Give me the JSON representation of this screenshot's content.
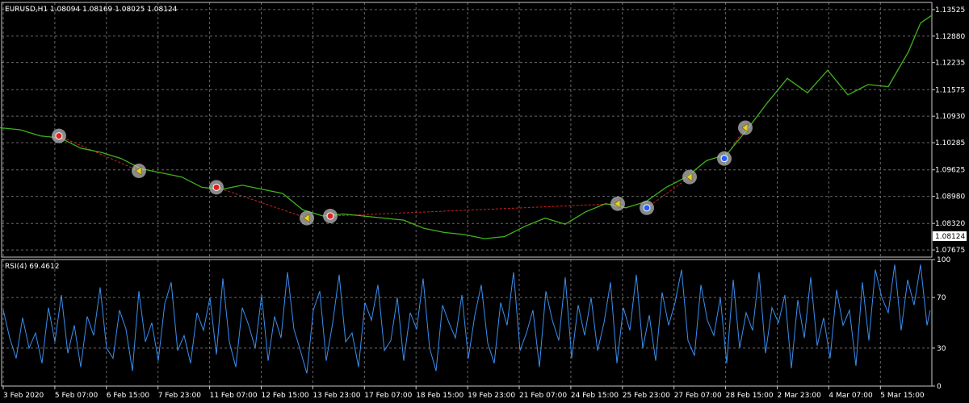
{
  "chart_data": [
    {
      "type": "line",
      "panel": "price",
      "title": "EURUSD,H1  1.08094 1.08169 1.08025 1.08124",
      "y_tick_labels": [
        "1.13525",
        "1.12880",
        "1.12235",
        "1.11575",
        "1.10930",
        "1.10285",
        "1.09625",
        "1.08980",
        "1.08320",
        "1.07675"
      ],
      "ylim": [
        1.075,
        1.137
      ],
      "current_price_label": "1.08124",
      "series": [
        {
          "color": "#3fb51b",
          "x": [
            0,
            25,
            50,
            75,
            100,
            125,
            150,
            175,
            200,
            225,
            250,
            275,
            300,
            325,
            350,
            375,
            400,
            425,
            450,
            475,
            500,
            525,
            550,
            575,
            600,
            625,
            650,
            675,
            700,
            725,
            750,
            775,
            800,
            825,
            850,
            875,
            900,
            925,
            950,
            975,
            1000,
            1025,
            1050,
            1075,
            1100,
            1125,
            1140,
            1155
          ],
          "values": [
            1.1065,
            1.106,
            1.1045,
            1.104,
            1.1015,
            1.1005,
            1.099,
            1.0965,
            1.0955,
            1.0945,
            1.092,
            1.0915,
            1.0925,
            1.0915,
            1.0905,
            1.0865,
            1.085,
            1.0855,
            1.085,
            1.0845,
            1.084,
            1.082,
            1.081,
            1.0805,
            1.0795,
            1.08,
            1.0825,
            1.0845,
            1.083,
            1.086,
            1.088,
            1.087,
            1.0885,
            1.092,
            1.0945,
            1.0985,
            1.1,
            1.106,
            1.1125,
            1.1185,
            1.115,
            1.1205,
            1.1145,
            1.117,
            1.1165,
            1.125,
            1.132,
            1.134
          ]
        }
      ],
      "markers": [
        {
          "x": 73,
          "y": 1.1045,
          "kind": "red"
        },
        {
          "x": 172,
          "y": 1.096,
          "kind": "yellow"
        },
        {
          "x": 268,
          "y": 1.092,
          "kind": "red"
        },
        {
          "x": 380,
          "y": 1.0845,
          "kind": "yellow"
        },
        {
          "x": 409,
          "y": 1.085,
          "kind": "red"
        },
        {
          "x": 765,
          "y": 1.088,
          "kind": "yellow"
        },
        {
          "x": 801,
          "y": 1.087,
          "kind": "blue"
        },
        {
          "x": 854,
          "y": 1.0945,
          "kind": "yellow"
        },
        {
          "x": 897,
          "y": 1.099,
          "kind": "blue"
        },
        {
          "x": 923,
          "y": 1.1065,
          "kind": "yellow"
        }
      ],
      "trade_lines": [
        {
          "x1": 73,
          "y1": 1.1045,
          "x2": 172,
          "y2": 1.096
        },
        {
          "x1": 268,
          "y1": 1.092,
          "x2": 380,
          "y2": 1.0845
        },
        {
          "x1": 409,
          "y1": 1.085,
          "x2": 765,
          "y2": 1.088
        },
        {
          "x1": 801,
          "y1": 1.087,
          "x2": 854,
          "y2": 1.0945
        },
        {
          "x1": 897,
          "y1": 1.099,
          "x2": 923,
          "y2": 1.1065
        }
      ]
    },
    {
      "type": "line",
      "panel": "indicator",
      "title": "RSI(4) 69.4612",
      "y_tick_labels": [
        "100",
        "70",
        "30",
        "0"
      ],
      "levels": [
        70,
        30
      ],
      "ylim": [
        0,
        100
      ],
      "series": [
        {
          "color": "#3a8ff0",
          "x": [
            4,
            12,
            20,
            28,
            36,
            44,
            52,
            60,
            68,
            76,
            84,
            92,
            100,
            108,
            116,
            124,
            132,
            140,
            148,
            156,
            164,
            172,
            180,
            188,
            196,
            204,
            212,
            220,
            228,
            236,
            244,
            252,
            260,
            268,
            276,
            284,
            292,
            300,
            308,
            316,
            324,
            332,
            340,
            348,
            356,
            364,
            372,
            380,
            388,
            396,
            404,
            412,
            420,
            428,
            436,
            444,
            452,
            460,
            468,
            476,
            484,
            492,
            500,
            508,
            516,
            524,
            532,
            540,
            548,
            556,
            564,
            572,
            580,
            588,
            596,
            604,
            612,
            620,
            628,
            636,
            644,
            652,
            660,
            668,
            676,
            684,
            692,
            700,
            708,
            716,
            724,
            732,
            740,
            748,
            756,
            764,
            772,
            780,
            788,
            796,
            804,
            812,
            820,
            828,
            836,
            844,
            852,
            860,
            868,
            876,
            884,
            892,
            900,
            908,
            916,
            924,
            932,
            940,
            948,
            956,
            964,
            972,
            980,
            988,
            996,
            1004,
            1012,
            1020,
            1028,
            1036,
            1044,
            1052,
            1060,
            1068,
            1076,
            1084,
            1092,
            1100,
            1108,
            1116,
            1124,
            1132,
            1140,
            1148,
            1152
          ],
          "values": [
            60,
            38,
            22,
            54,
            30,
            42,
            18,
            62,
            35,
            72,
            26,
            48,
            15,
            55,
            40,
            78,
            30,
            22,
            60,
            45,
            12,
            75,
            35,
            50,
            20,
            65,
            82,
            28,
            40,
            18,
            58,
            44,
            70,
            25,
            85,
            35,
            15,
            62,
            48,
            30,
            72,
            20,
            55,
            38,
            90,
            45,
            28,
            10,
            60,
            75,
            20,
            50,
            88,
            35,
            42,
            15,
            66,
            52,
            80,
            28,
            36,
            70,
            20,
            58,
            45,
            85,
            30,
            12,
            64,
            50,
            38,
            72,
            22,
            56,
            80,
            34,
            18,
            66,
            48,
            90,
            28,
            42,
            60,
            15,
            75,
            52,
            36,
            86,
            22,
            64,
            40,
            70,
            28,
            50,
            82,
            18,
            62,
            44,
            88,
            30,
            56,
            20,
            74,
            48,
            66,
            92,
            36,
            24,
            80,
            52,
            40,
            70,
            18,
            84,
            30,
            58,
            44,
            90,
            26,
            62,
            50,
            72,
            14,
            68,
            38,
            86,
            32,
            54,
            22,
            76,
            48,
            60,
            16,
            82,
            36,
            92,
            70,
            58,
            96,
            44,
            84,
            64,
            96,
            48,
            60
          ]
        }
      ]
    }
  ],
  "x_tick_labels": [
    "3 Feb 2020",
    "5 Feb 07:00",
    "6 Feb 15:00",
    "7 Feb 23:00",
    "11 Feb 07:00",
    "12 Feb 15:00",
    "13 Feb 23:00",
    "17 Feb 07:00",
    "18 Feb 15:00",
    "19 Feb 23:00",
    "21 Feb 07:00",
    "24 Feb 15:00",
    "25 Feb 23:00",
    "27 Feb 07:00",
    "28 Feb 15:00",
    "2 Mar 23:00",
    "4 Mar 07:00",
    "5 Mar 15:00"
  ],
  "colors": {
    "background": "#000000",
    "price_line": "#3fb51b",
    "rsi_line": "#3a8ff0",
    "trade_line": "#d02020",
    "grid": "#8a8a8a"
  }
}
